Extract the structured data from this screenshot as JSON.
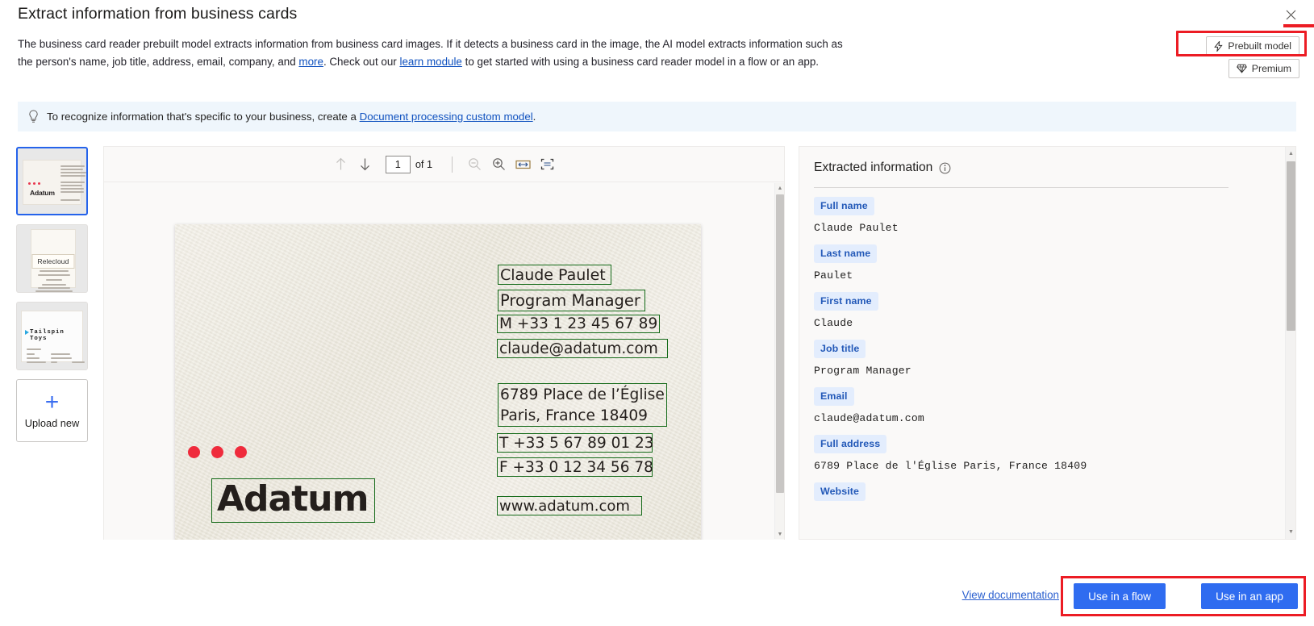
{
  "header": {
    "title": "Extract information from business cards",
    "close_icon": "close-icon",
    "description_part1": "The business card reader prebuilt model extracts information from business card images. If it detects a business card in the image, the AI model extracts information such as the person's name, job title, address, email, company, and ",
    "description_link1": "more",
    "description_part2": ". Check out our ",
    "description_link2": "learn module",
    "description_part3": " to get started with using a business card reader model in a flow or an app.",
    "badges": [
      {
        "label": "Prebuilt model",
        "icon": "lightning-bolt-icon"
      },
      {
        "label": "Premium",
        "icon": "diamond-icon"
      }
    ]
  },
  "banner": {
    "icon": "lightbulb-icon",
    "text_before": "To recognize information that's specific to your business, create a ",
    "link": "Document processing custom model",
    "text_after": "."
  },
  "thumbnails": {
    "items": [
      {
        "name": "Adatum",
        "selected": true
      },
      {
        "name": "Relecloud",
        "selected": false
      },
      {
        "name": "Tailspin Toys",
        "selected": false
      }
    ],
    "upload": {
      "label": "Upload new",
      "icon": "plus-icon"
    }
  },
  "viewer": {
    "toolbar": {
      "prev_icon": "arrow-up-icon",
      "next_icon": "arrow-down-icon",
      "page_value": "1",
      "page_total_label": "of 1",
      "zoom_out_icon": "zoom-out-icon",
      "zoom_in_icon": "zoom-in-icon",
      "fit_width_icon": "fit-width-icon",
      "fit_page_icon": "fit-page-icon"
    },
    "card": {
      "company": "Adatum",
      "ocr_lines": [
        "Claude Paulet",
        "Program Manager",
        "M +33 1 23 45 67 89",
        "claude@adatum.com",
        "6789 Place de l’Église",
        "Paris, France 18409",
        "T +33 5 67 89 01 23",
        "F +33 0 12 34 56 78",
        "www.adatum.com"
      ]
    }
  },
  "extracted": {
    "heading": "Extracted information",
    "info_icon": "info-icon",
    "fields": [
      {
        "label": "Full name",
        "value": "Claude Paulet"
      },
      {
        "label": "Last name",
        "value": "Paulet"
      },
      {
        "label": "First name",
        "value": "Claude"
      },
      {
        "label": "Job title",
        "value": "Program Manager"
      },
      {
        "label": "Email",
        "value": "claude@adatum.com"
      },
      {
        "label": "Full address",
        "value": "6789 Place de l'Église Paris, France 18409"
      },
      {
        "label": "Website",
        "value": ""
      }
    ]
  },
  "footer": {
    "documentation_link": "View documentation",
    "use_in_flow": "Use in a flow",
    "use_in_app": "Use in an app"
  },
  "colors": {
    "accent_blue": "#2f6cf0",
    "link_blue": "#0f51bf",
    "pill_bg": "#e3edfd",
    "pill_text": "#2359b8",
    "banner_bg": "#eff6fc",
    "annotation_red": "#ec1c24",
    "ocr_box_green": "#146a18"
  }
}
